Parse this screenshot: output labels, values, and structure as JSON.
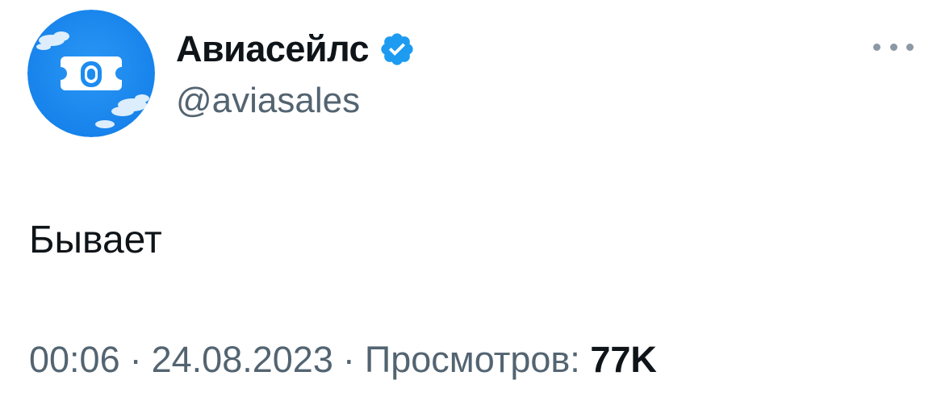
{
  "author": {
    "display_name": "Авиасейлс",
    "handle": "@aviasales",
    "verified": true,
    "avatar_icon": "aviasales-logo-icon",
    "avatar_color": "#1d8cf0",
    "badge_color": "#1d9bf0"
  },
  "tweet": {
    "text": "Бывает"
  },
  "meta": {
    "time": "00:06",
    "separator": "·",
    "date": "24.08.2023",
    "views_label": "Просмотров:",
    "views_count": "77K"
  },
  "colors": {
    "primary_text": "#0f1419",
    "secondary_text": "#536471"
  }
}
